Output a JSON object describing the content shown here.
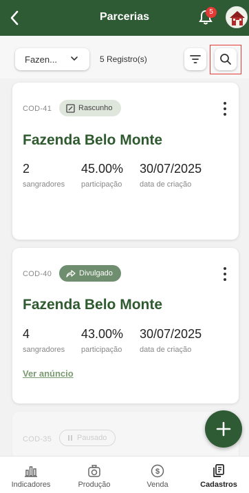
{
  "header": {
    "title": "Parcerias",
    "notification_count": "5"
  },
  "toolbar": {
    "farm_filter": "Fazen...",
    "records": "5 Registro(s)"
  },
  "cards": [
    {
      "code": "COD-41",
      "status": "Rascunho",
      "title": "Fazenda Belo Monte",
      "stats": [
        {
          "value": "2",
          "label": "sangradores"
        },
        {
          "value": "45.00%",
          "label": "participação"
        },
        {
          "value": "30/07/2025",
          "label": "data de criação"
        }
      ]
    },
    {
      "code": "COD-40",
      "status": "Divulgado",
      "title": "Fazenda Belo Monte",
      "stats": [
        {
          "value": "4",
          "label": "sangradores"
        },
        {
          "value": "43.00%",
          "label": "participação"
        },
        {
          "value": "30/07/2025",
          "label": "data de criação"
        }
      ],
      "link": "Ver anúncio"
    },
    {
      "code": "COD-35",
      "status": "Pausado"
    }
  ],
  "nav": [
    {
      "label": "Indicadores",
      "icon": "bar-chart-icon"
    },
    {
      "label": "Produção",
      "icon": "scale-icon"
    },
    {
      "label": "Venda",
      "icon": "dollar-icon"
    },
    {
      "label": "Cadastros",
      "icon": "documents-icon",
      "active": true
    }
  ],
  "colors": {
    "primary": "#2e5a34",
    "badge": "#e53935",
    "title_green": "#2f5a2f",
    "draft_tag": "#dfe6dc",
    "published_tag": "#6f8e6f"
  }
}
